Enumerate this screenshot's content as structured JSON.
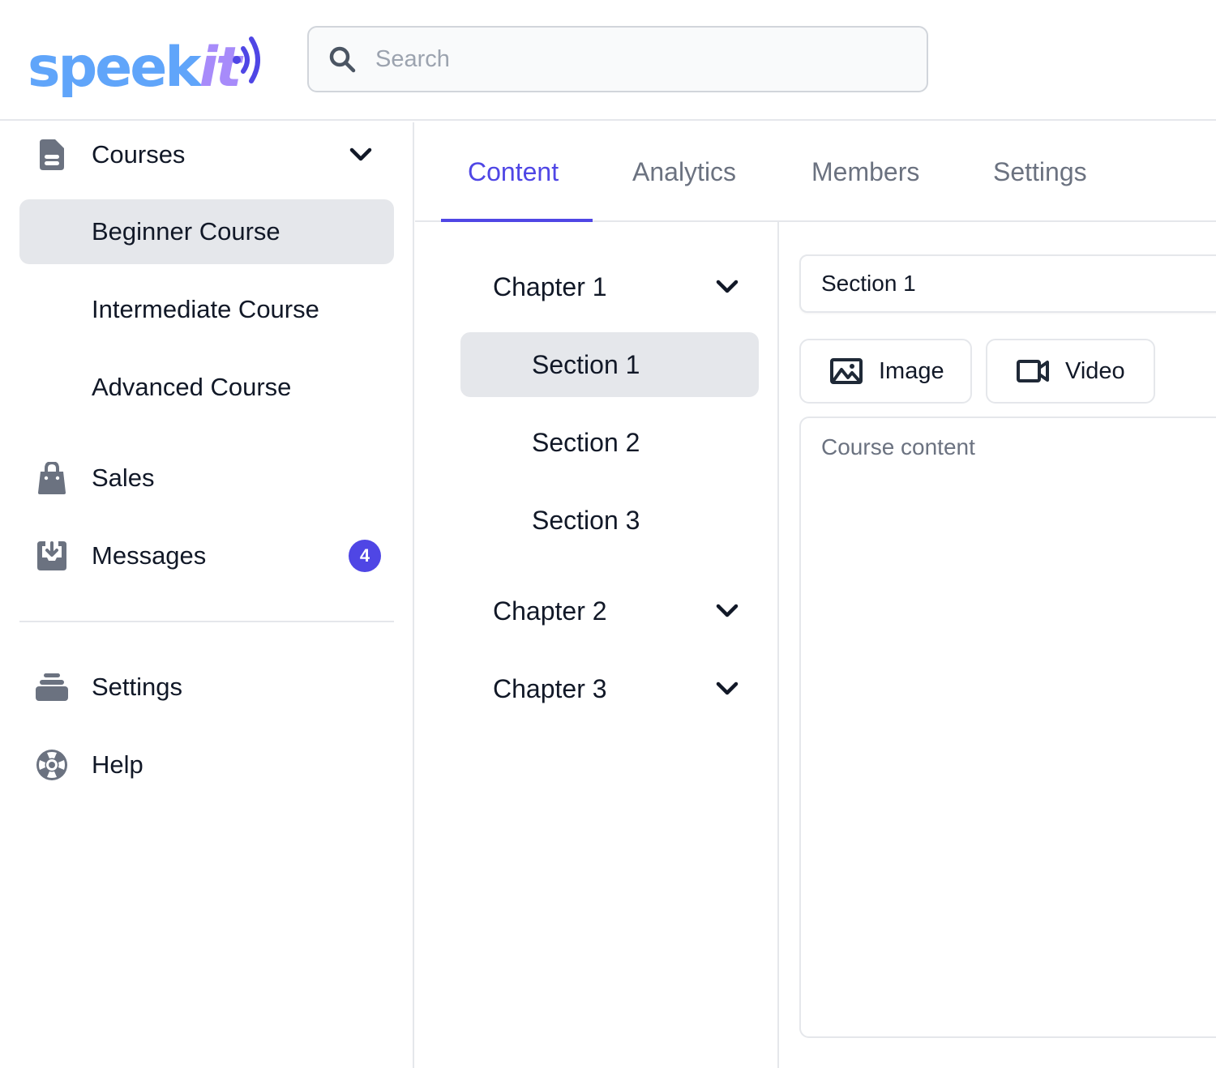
{
  "app": {
    "logo": {
      "part1": "speek",
      "part2": "it"
    },
    "colors": {
      "accent": "#4f46e5",
      "logo_blue": "#60a5fa",
      "logo_purple": "#a78bfa",
      "icon_gray": "#6b7280",
      "active_bg": "#e5e7eb"
    }
  },
  "search": {
    "placeholder": "Search",
    "value": "",
    "icon": "search-icon"
  },
  "sidebar": {
    "courses": {
      "label": "Courses",
      "icon": "document-icon",
      "expanded": true,
      "items": [
        {
          "label": "Beginner Course",
          "active": true
        },
        {
          "label": "Intermediate Course",
          "active": false
        },
        {
          "label": "Advanced Course",
          "active": false
        }
      ]
    },
    "sales": {
      "label": "Sales",
      "icon": "shopping-bag-icon"
    },
    "messages": {
      "label": "Messages",
      "icon": "inbox-download-icon",
      "badge": "4"
    },
    "settings": {
      "label": "Settings",
      "icon": "stack-icon"
    },
    "help": {
      "label": "Help",
      "icon": "lifebuoy-icon"
    }
  },
  "tabs": [
    {
      "label": "Content",
      "active": true
    },
    {
      "label": "Analytics",
      "active": false
    },
    {
      "label": "Members",
      "active": false
    },
    {
      "label": "Settings",
      "active": false
    }
  ],
  "chapters": [
    {
      "label": "Chapter 1",
      "expanded": true,
      "sections": [
        {
          "label": "Section 1",
          "active": true
        },
        {
          "label": "Section 2",
          "active": false
        },
        {
          "label": "Section 3",
          "active": false
        }
      ]
    },
    {
      "label": "Chapter 2",
      "expanded": false
    },
    {
      "label": "Chapter 3",
      "expanded": false
    }
  ],
  "editor": {
    "title_value": "Section 1",
    "image_button": "Image",
    "video_button": "Video",
    "content_placeholder": "Course content",
    "content_value": ""
  }
}
